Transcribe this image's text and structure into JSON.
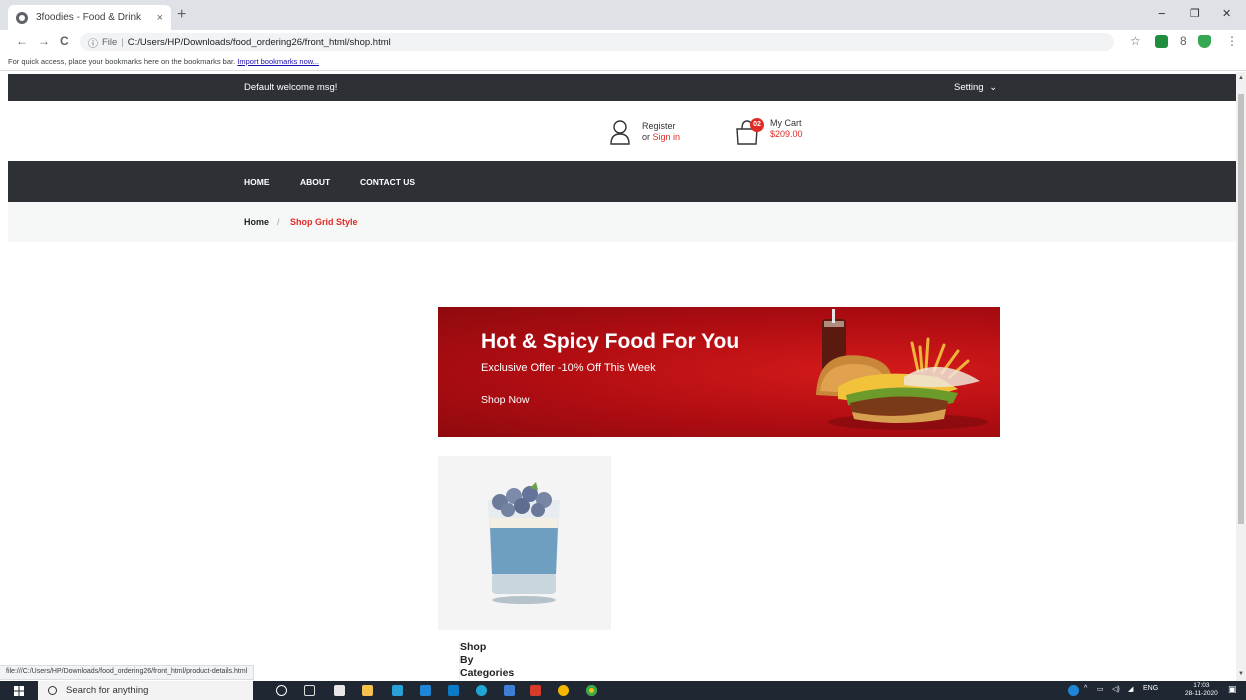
{
  "browser": {
    "tab_title": "3foodies - Food & Drink",
    "tab_close": "×",
    "new_tab": "+",
    "win_min": "−",
    "win_max": "❐",
    "win_close": "✕",
    "back": "←",
    "forward": "→",
    "reload": "C",
    "url_info": "ⓘ",
    "url_scheme": "File",
    "url_sep": "|",
    "url_path": "C:/Users/HP/Downloads/food_ordering26/front_html/shop.html",
    "bookmarks_msg": "For quick access, place your bookmarks here on the bookmarks bar.",
    "bookmarks_link": "Import bookmarks now...",
    "status_url": "file:///C:/Users/HP/Downloads/food_ordering26/front_html/product-details.html"
  },
  "site": {
    "welcome": "Default welcome msg!",
    "setting": "Setting",
    "setting_caret": "⌄",
    "register": "Register",
    "or": "or",
    "sign_in": "Sign in",
    "cart_label": "My Cart",
    "cart_count": "02",
    "cart_total": "$209.00",
    "nav": [
      "HOME",
      "ABOUT",
      "CONTACT US"
    ],
    "breadcrumb": {
      "home": "Home",
      "sep": "/",
      "current": "Shop Grid Style"
    },
    "banner": {
      "title": "Hot & Spicy Food For You",
      "offer": "Exclusive Offer -10% Off This Week",
      "cta": "Shop Now"
    },
    "sidebar_title": [
      "Shop",
      "By",
      "Categories"
    ]
  },
  "taskbar": {
    "search_placeholder": "Search for anything",
    "tray_caret": "^",
    "lang": "ENG",
    "time": "17:03",
    "date": "28-11-2020"
  },
  "colors": {
    "dark_bar": "#2d3035",
    "accent_red": "#e02b27",
    "banner_red": "#b00d12"
  }
}
